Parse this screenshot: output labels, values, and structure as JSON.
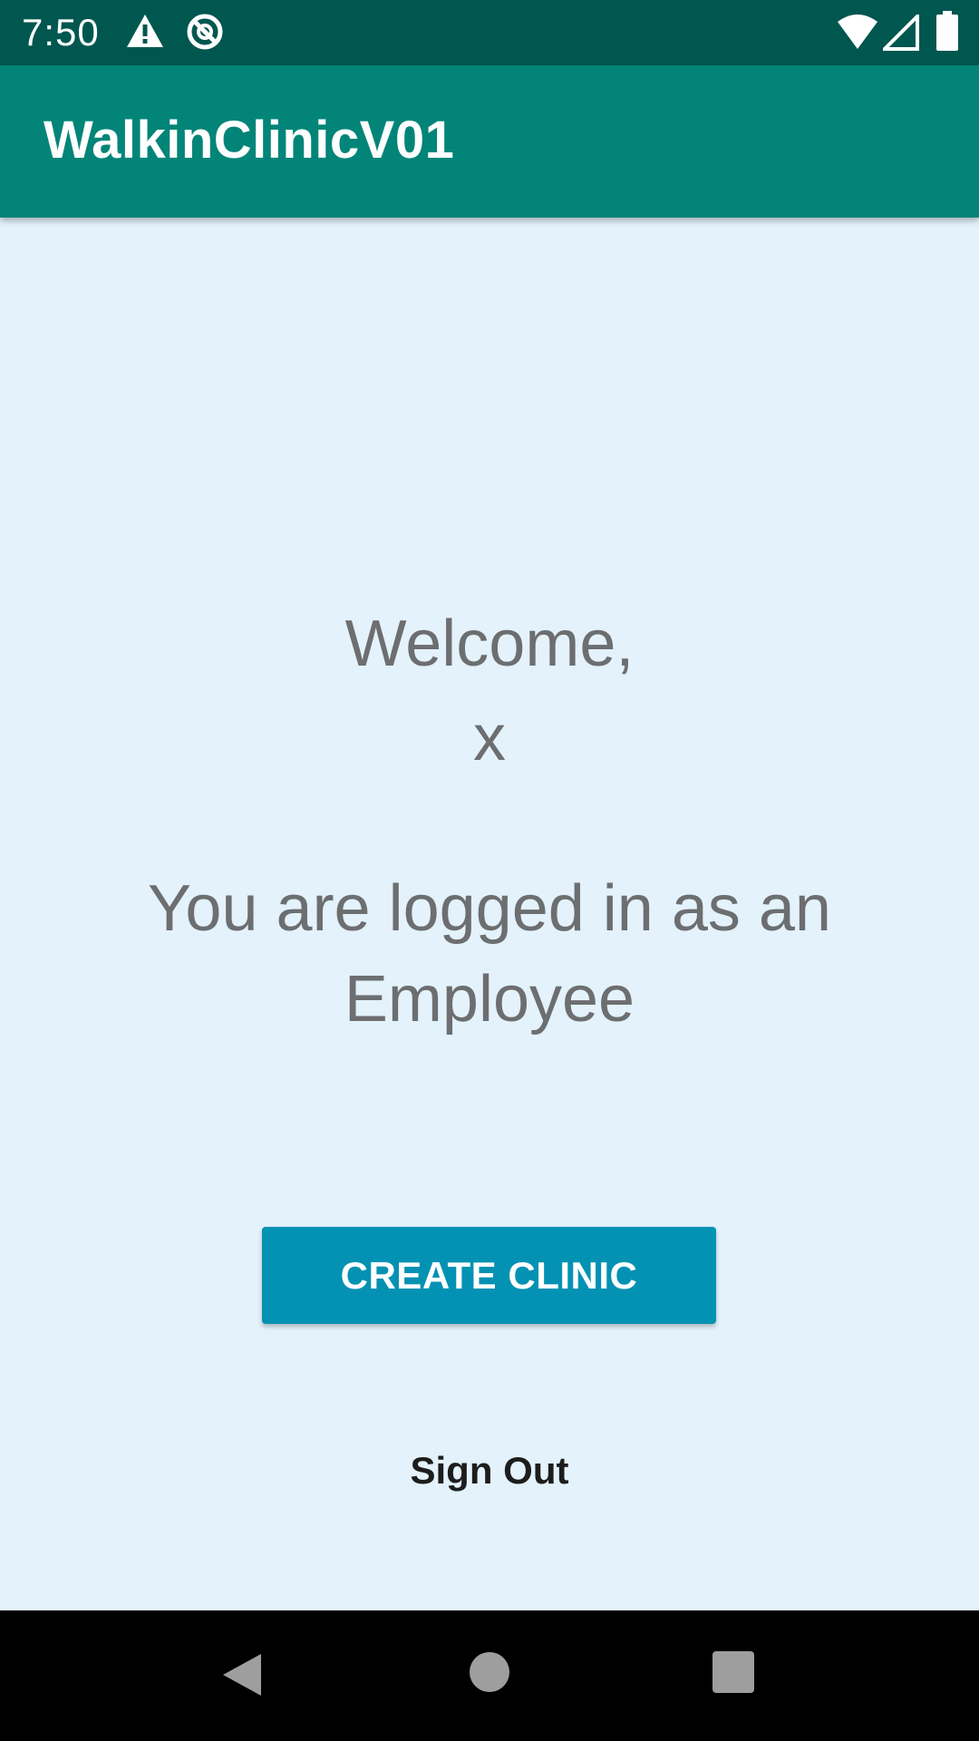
{
  "status_bar": {
    "time": "7:50",
    "icons": [
      "warning-icon",
      "no-sim-icon",
      "wifi-icon",
      "signal-icon",
      "battery-icon"
    ],
    "background": "#00574f"
  },
  "app_bar": {
    "title": "WalkinClinicV01",
    "color": "#028578"
  },
  "main": {
    "welcome": "Welcome,",
    "username": "x",
    "role_message": "You are logged in as an Employee",
    "create_clinic_label": "CREATE CLINIC",
    "sign_out_label": "Sign Out",
    "background": "#e3f2fb",
    "button_color": "#0392b3"
  },
  "nav_bar": {
    "buttons": [
      "back-icon",
      "home-icon",
      "recents-icon"
    ]
  }
}
